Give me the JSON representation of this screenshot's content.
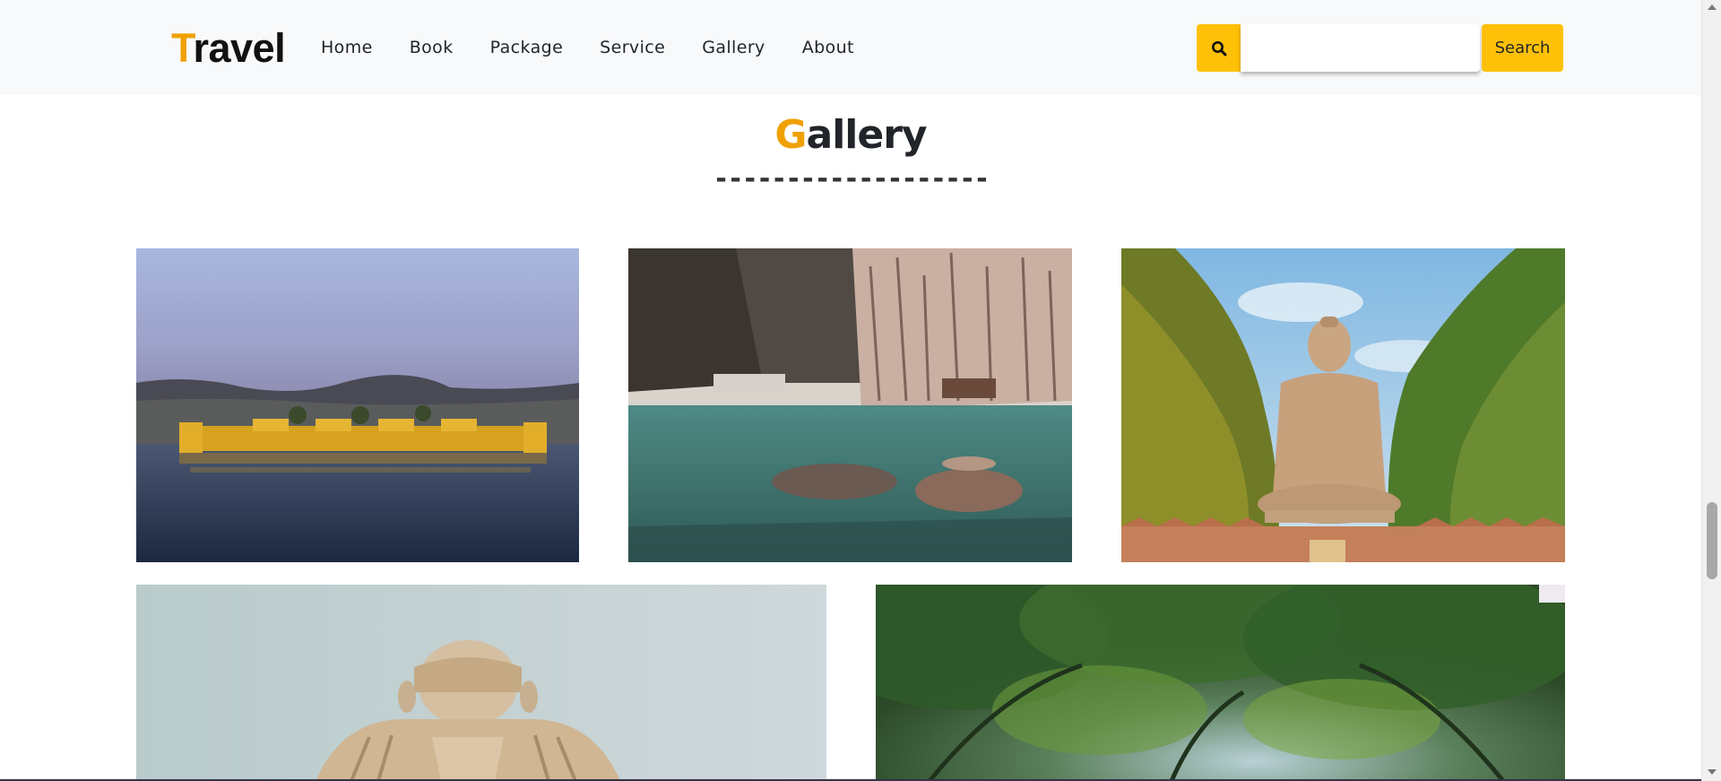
{
  "navbar": {
    "brand_first": "T",
    "brand_rest": "ravel",
    "links": [
      "Home",
      "Book",
      "Package",
      "Service",
      "Gallery",
      "About"
    ],
    "search_button_label": "Search",
    "search_icon": "search-icon"
  },
  "gallery": {
    "title_first": "G",
    "title_rest": "allery",
    "divider": "-------------------",
    "photos": [
      "photo-jal-mahal-palace-on-lake",
      "photo-mountain-lake-with-trees",
      "photo-great-buddha-statue",
      "photo-buddha-statue-closeup",
      "photo-forest-canopy"
    ]
  },
  "colors": {
    "accent": "#ffc107",
    "brand_accent": "#f0a000",
    "navbar_bg": "#f8f9fa",
    "text": "#212529"
  }
}
